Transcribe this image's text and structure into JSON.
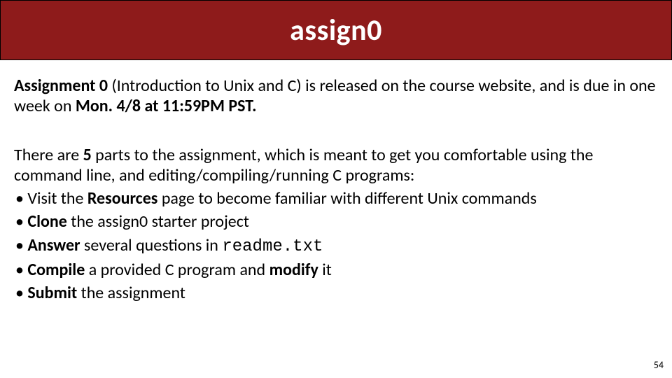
{
  "title": "assign0",
  "para1": {
    "lead_bold": "Assignment 0",
    "mid": " (Introduction to Unix and C) is released on the course website, and is due in one week on ",
    "date_bold": "Mon. 4/8 at 11:59PM PST.",
    "tail": ""
  },
  "para2": {
    "pre": "There are ",
    "count_bold": "5",
    "post": " parts to the assignment, which is meant to get you comfortable using the command line, and editing/compiling/running C programs:"
  },
  "bullets": [
    {
      "pre": "Visit the ",
      "b1": "Resources",
      "mid": " page to become familiar with different Unix commands",
      "b2": "",
      "post": ""
    },
    {
      "pre": "",
      "b1": "Clone",
      "mid": " the assign0 starter project",
      "b2": "",
      "post": ""
    },
    {
      "pre": "",
      "b1": "Answer",
      "mid": " several questions in ",
      "mono": "readme.txt",
      "b2": "",
      "post": ""
    },
    {
      "pre": "",
      "b1": "Compile",
      "mid": " a provided C program and ",
      "b2": "modify",
      "post": " it"
    },
    {
      "pre": "",
      "b1": "Submit",
      "mid": " the assignment",
      "b2": "",
      "post": ""
    }
  ],
  "page_number": "54"
}
